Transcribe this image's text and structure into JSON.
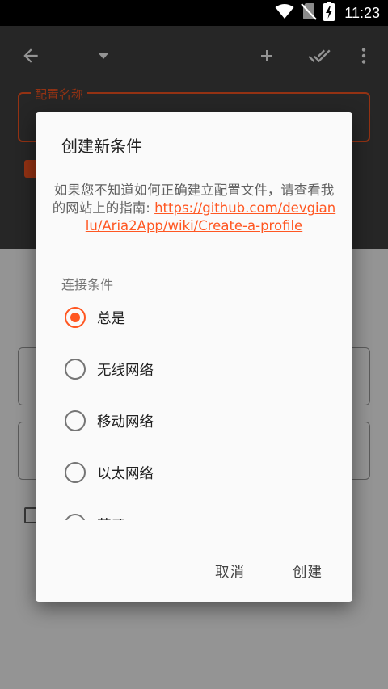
{
  "status_bar": {
    "time": "11:23",
    "icons": [
      "wifi-icon",
      "no-sim-icon",
      "battery-charging-icon"
    ]
  },
  "app_bar": {
    "icons": [
      "back-arrow-icon",
      "dropdown-triangle-icon",
      "add-icon",
      "done-all-icon",
      "more-vert-icon"
    ]
  },
  "background_form": {
    "profile_name_label": "配置名称"
  },
  "dialog": {
    "title": "创建新条件",
    "message_text": "如果您不知道如何正确建立配置文件，请查看我的网站上的指南: ",
    "message_link": "https://github.com/devgianlu/Aria2App/wiki/Create-a-profile",
    "section_label": "连接条件",
    "options": [
      {
        "label": "总是",
        "selected": true
      },
      {
        "label": "无线网络",
        "selected": false
      },
      {
        "label": "移动网络",
        "selected": false
      },
      {
        "label": "以太网络",
        "selected": false
      },
      {
        "label": "蓝牙",
        "selected": false
      }
    ],
    "cancel_label": "取消",
    "create_label": "创建"
  },
  "colors": {
    "accent": "#ff5722",
    "app_bar": "#424242",
    "status_bar": "#000000",
    "dialog_bg": "#fafafa"
  }
}
